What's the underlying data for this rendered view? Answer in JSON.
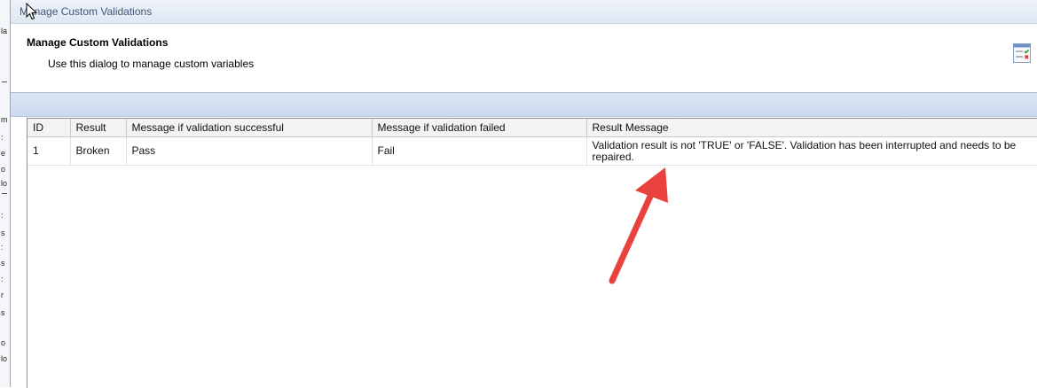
{
  "window": {
    "title": "Manage Custom Validations"
  },
  "header": {
    "title": "Manage Custom Validations",
    "description": "Use this dialog to manage custom variables",
    "icon": "validation-list-icon"
  },
  "table": {
    "columns": [
      "ID",
      "Result",
      "Message if validation successful",
      "Message if validation failed",
      "Result Message"
    ],
    "rows": [
      {
        "id": "1",
        "result": "Broken",
        "success_message": "Pass",
        "failed_message": "Fail",
        "result_message": "Validation result is not 'TRUE' or 'FALSE'. Validation has been interrupted and needs to be repaired."
      }
    ]
  },
  "background_fragments": [
    "la",
    "m",
    ":",
    "e",
    "o",
    "lo",
    ":",
    "s",
    ":",
    "s",
    ":",
    "r",
    "s",
    "o",
    "lo"
  ],
  "annotation": {
    "type": "red-arrow",
    "color": "#e8413e"
  }
}
